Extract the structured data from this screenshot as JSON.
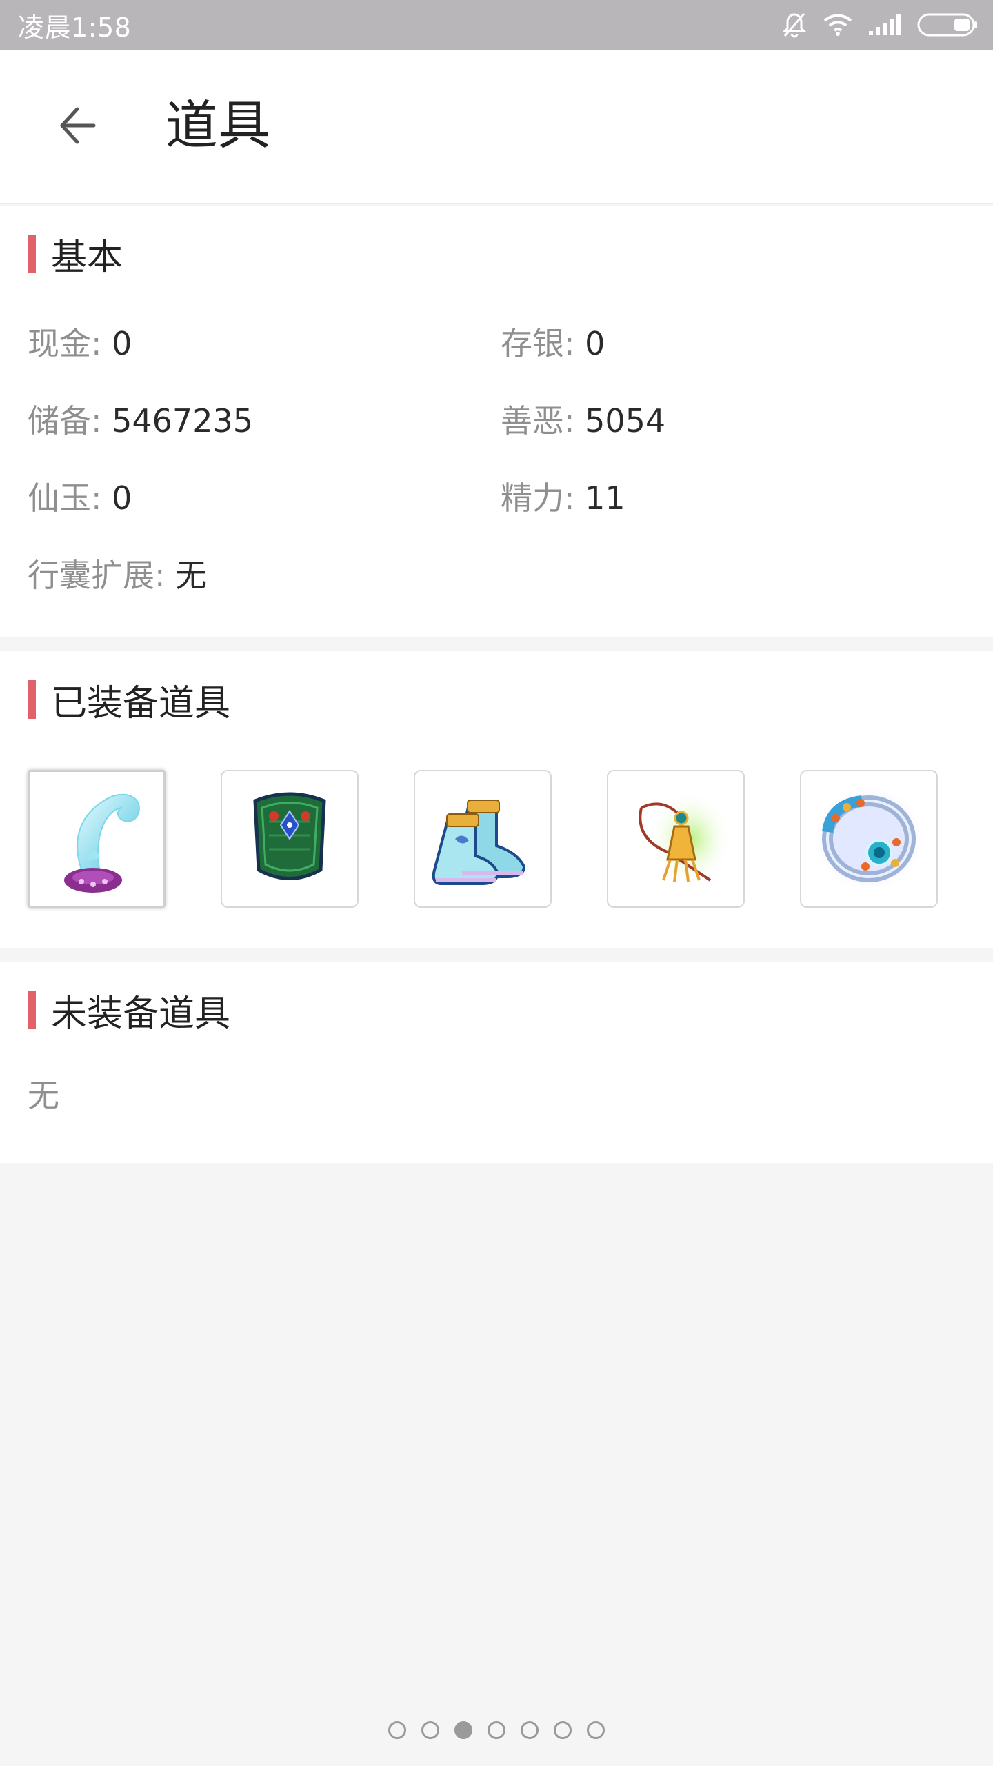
{
  "status_bar": {
    "time": "凌晨1:58",
    "icons": [
      "bell-off-icon",
      "wifi-icon",
      "signal-icon",
      "battery-icon"
    ]
  },
  "app_bar": {
    "back_icon": "arrow-left-icon",
    "title": "道具"
  },
  "basic": {
    "title": "基本",
    "fields": [
      {
        "label": "现金",
        "value": "0"
      },
      {
        "label": "存银",
        "value": "0"
      },
      {
        "label": "储备",
        "value": "5467235"
      },
      {
        "label": "善恶",
        "value": "5054"
      },
      {
        "label": "仙玉",
        "value": "0"
      },
      {
        "label": "精力",
        "value": "11"
      },
      {
        "label": "行囊扩展",
        "value": "无"
      }
    ],
    "separator": ":"
  },
  "equipped": {
    "title": "已装备道具",
    "items": [
      {
        "icon": "hat-icon",
        "selected": true
      },
      {
        "icon": "armor-icon",
        "selected": false
      },
      {
        "icon": "boots-icon",
        "selected": false
      },
      {
        "icon": "pendant-icon",
        "selected": false
      },
      {
        "icon": "ring-icon",
        "selected": false
      }
    ]
  },
  "unequipped": {
    "title": "未装备道具",
    "empty_text": "无"
  },
  "pager": {
    "total": 7,
    "active_index": 2
  },
  "colors": {
    "accent": "#e0626a",
    "status_bar": "#b8b6b9",
    "background": "#f5f5f5"
  }
}
